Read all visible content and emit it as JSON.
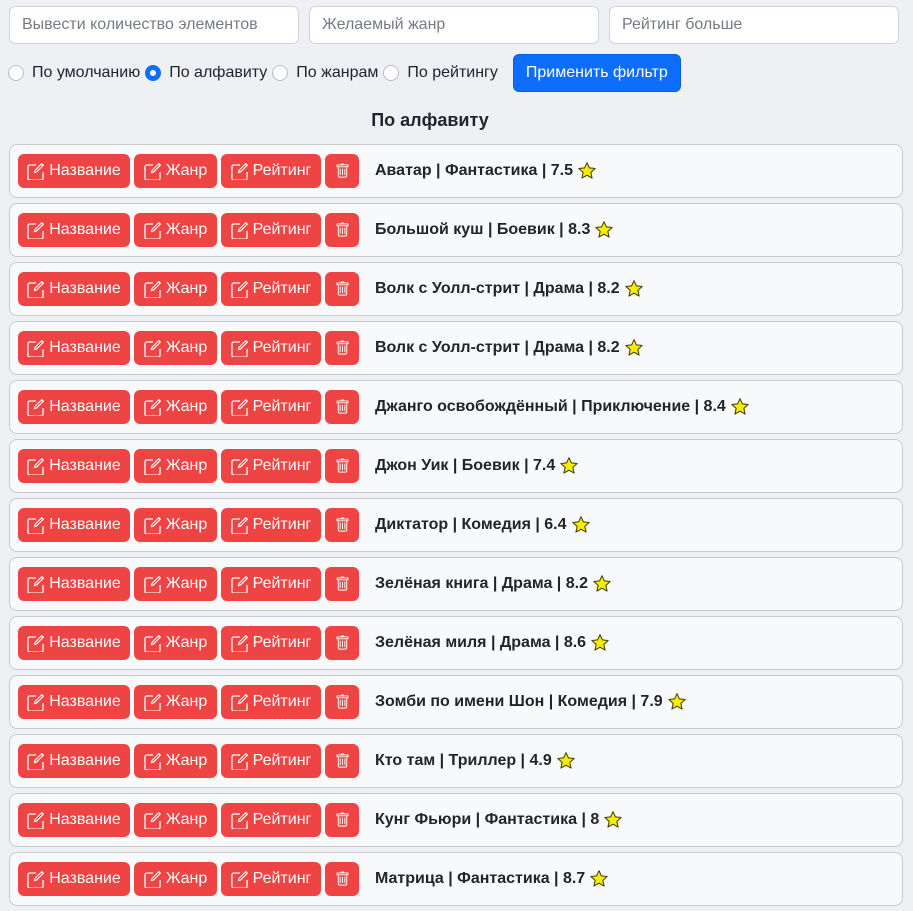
{
  "search": {
    "count_placeholder": "Вывести количество элементов",
    "genre_placeholder": "Желаемый жанр",
    "rating_placeholder": "Рейтинг больше"
  },
  "sort_options": [
    {
      "label": "По умолчанию",
      "checked": false
    },
    {
      "label": "По алфавиту",
      "checked": true
    },
    {
      "label": "По жанрам",
      "checked": false
    },
    {
      "label": "По рейтингу",
      "checked": false
    }
  ],
  "apply_button": "Применить фильтр",
  "list_heading": "По алфавиту",
  "row_buttons": {
    "name": "Название",
    "genre": "Жанр",
    "rating": "Рейтинг"
  },
  "colors": {
    "danger": "#ef4444",
    "primary": "#0d6efd",
    "star": "#f5ec00"
  },
  "movies": [
    {
      "text": "Аватар | Фантастика | 7.5"
    },
    {
      "text": "Большой куш | Боевик | 8.3"
    },
    {
      "text": "Волк с Уолл-стрит | Драма | 8.2"
    },
    {
      "text": "Волк с Уолл-стрит | Драма | 8.2"
    },
    {
      "text": "Джанго освобождённый | Приключение | 8.4"
    },
    {
      "text": "Джон Уик | Боевик | 7.4"
    },
    {
      "text": "Диктатор | Комедия | 6.4"
    },
    {
      "text": "Зелёная книга | Драма | 8.2"
    },
    {
      "text": "Зелёная миля | Драма | 8.6"
    },
    {
      "text": "Зомби по имени Шон | Комедия | 7.9"
    },
    {
      "text": "Кто там | Триллер | 4.9"
    },
    {
      "text": "Кунг Фьюри | Фантастика | 8"
    },
    {
      "text": "Матрица | Фантастика | 8.7"
    }
  ]
}
